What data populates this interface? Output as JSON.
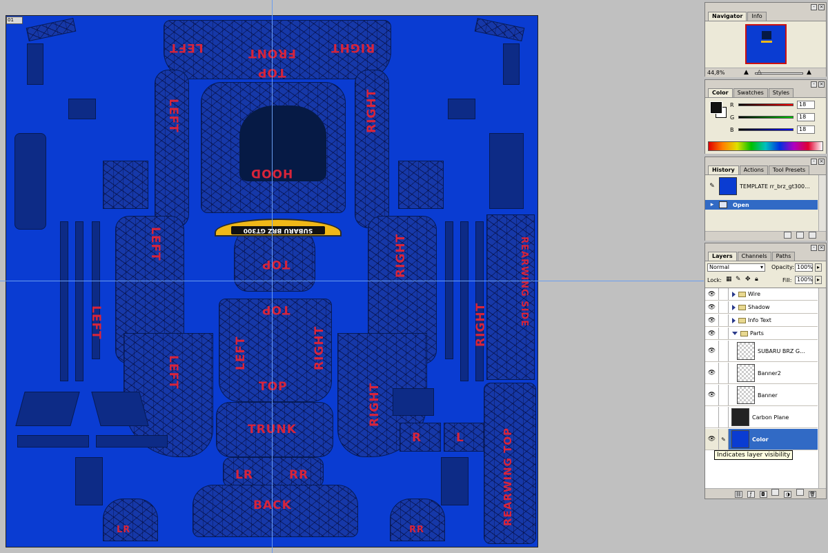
{
  "document": {
    "id_badge": "01",
    "labels": {
      "left_top": "LEFT",
      "front_top": "TOP",
      "front": "FRONT",
      "right_top": "RIGHT",
      "left_side_upper": "LEFT",
      "right_side_upper": "RIGHT",
      "hood": "HOOD",
      "banner_text": "SUBARU BRZ GT300",
      "roof_top": "TOP",
      "roof_top2": "TOP",
      "door_left": "LEFT",
      "door_right": "RIGHT",
      "rear_wing_top_side": "REARWING SIDE",
      "left_far": "LEFT",
      "right_far": "RIGHT",
      "left_mid": "LEFT",
      "right_mid": "RIGHT",
      "left_center": "LEFT",
      "right_center": "RIGHT",
      "top_trunk": "TOP",
      "trunk": "TRUNK",
      "lr": "LR",
      "rr": "RR",
      "back": "BACK",
      "r_small": "R",
      "l_small": "L",
      "rearwing_top": "REARWING TOP",
      "lr_small": "LR",
      "rr_small": "RR"
    }
  },
  "navigator": {
    "tabs": [
      "Navigator",
      "Info"
    ],
    "zoom": "44,8%"
  },
  "color": {
    "tabs": [
      "Color",
      "Swatches",
      "Styles"
    ],
    "channels": [
      {
        "name": "R",
        "value": "18",
        "color": "#d01010"
      },
      {
        "name": "G",
        "value": "18",
        "color": "#10a010"
      },
      {
        "name": "B",
        "value": "18",
        "color": "#1020c0"
      }
    ],
    "foreground": "#121212"
  },
  "history": {
    "tabs": [
      "History",
      "Actions",
      "Tool Presets"
    ],
    "snapshot": "TEMPLATE rr_brz_gt300...",
    "step": "Open"
  },
  "layers": {
    "tabs": [
      "Layers",
      "Channels",
      "Paths"
    ],
    "blend_mode": "Normal",
    "opacity_label": "Opacity:",
    "opacity": "100%",
    "lock_label": "Lock:",
    "fill_label": "Fill:",
    "fill": "100%",
    "items": [
      {
        "name": "Wire",
        "type": "folder",
        "visible": true,
        "expanded": false
      },
      {
        "name": "Shadow",
        "type": "folder",
        "visible": true,
        "expanded": false
      },
      {
        "name": "Info Text",
        "type": "folder",
        "visible": true,
        "expanded": false
      },
      {
        "name": "Parts",
        "type": "folder",
        "visible": true,
        "expanded": true
      },
      {
        "name": "SUBARU BRZ G...",
        "type": "layer",
        "visible": true
      },
      {
        "name": "Banner2",
        "type": "layer",
        "visible": true
      },
      {
        "name": "Banner",
        "type": "layer",
        "visible": true
      },
      {
        "name": "Carbon Plane",
        "type": "layer",
        "visible": false
      },
      {
        "name": "Color",
        "type": "layer",
        "visible": true,
        "selected": true
      }
    ],
    "tooltip": "Indicates layer visibility"
  },
  "colors": {
    "canvas_blue": "#0a3cd2",
    "label_red": "#d8243a",
    "selection_blue": "#316ac5",
    "banner_yellow": "#f0b818"
  }
}
